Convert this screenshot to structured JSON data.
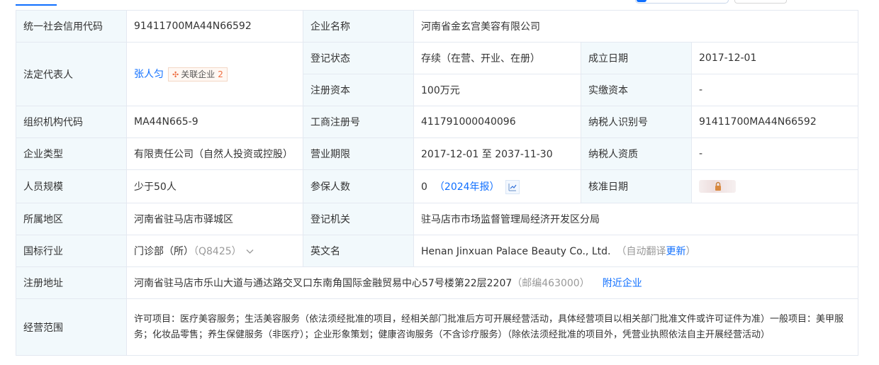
{
  "colors": {
    "accent": "#0f6fff",
    "label_bg": "#f2f9fc",
    "border": "#e4e9f1",
    "tag_orange": "#ef6c3e"
  },
  "rows": {
    "credit_code": {
      "label": "统一社会信用代码",
      "value": "91411700MA44N66592"
    },
    "company_name": {
      "label": "企业名称",
      "value": "河南省金玄宫美容有限公司"
    },
    "legal_rep": {
      "label": "法定代表人",
      "name": "张人匀",
      "tag_label": "关联企业",
      "tag_count": "2"
    },
    "reg_status": {
      "label": "登记状态",
      "value": "存续（在营、开业、在册）"
    },
    "founded": {
      "label": "成立日期",
      "value": "2017-12-01"
    },
    "reg_capital": {
      "label": "注册资本",
      "value": "100万元"
    },
    "paid_capital": {
      "label": "实缴资本",
      "value": "-"
    },
    "org_code": {
      "label": "组织机构代码",
      "value": "MA44N665-9"
    },
    "business_reg_no": {
      "label": "工商注册号",
      "value": "411791000040096"
    },
    "taxpayer_id": {
      "label": "纳税人识别号",
      "value": "91411700MA44N66592"
    },
    "company_type": {
      "label": "企业类型",
      "value": "有限责任公司（自然人投资或控股）"
    },
    "business_term": {
      "label": "营业期限",
      "value": "2017-12-01 至 2037-11-30"
    },
    "taxpayer_qual": {
      "label": "纳税人资质",
      "value": "-"
    },
    "staff_size": {
      "label": "人员规模",
      "value": "少于50人"
    },
    "insured": {
      "label": "参保人数",
      "value": "0",
      "year_link": "（2024年报）"
    },
    "approval_date": {
      "label": "核准日期"
    },
    "region": {
      "label": "所属地区",
      "value": "河南省驻马店市驿城区"
    },
    "reg_authority": {
      "label": "登记机关",
      "value": "驻马店市市场监督管理局经济开发区分局"
    },
    "industry": {
      "label": "国标行业",
      "value": "门诊部（所）",
      "code": "（Q8425）"
    },
    "english_name": {
      "label": "英文名",
      "value": "Henan Jinxuan Palace Beauty Co., Ltd.",
      "note": "（自动翻译",
      "update_link": "更新",
      "note_end": "）"
    },
    "address": {
      "label": "注册地址",
      "value": "河南省驻马店市乐山大道与通达路交叉口东南角国际金融贸易中心57号楼第22层2207",
      "postcode": "（邮编463000）",
      "nearby_link": "附近企业"
    },
    "scope": {
      "label": "经营范围",
      "value": "许可项目：医疗美容服务；生活美容服务（依法须经批准的项目，经相关部门批准后方可开展经营活动，具体经营项目以相关部门批准文件或许可证件为准）一般项目：美甲服务；化妆品零售；养生保健服务（非医疗）；企业形象策划；健康咨询服务（不含诊疗服务）（除依法须经批准的项目外，凭营业执照依法自主开展经营活动）"
    }
  }
}
